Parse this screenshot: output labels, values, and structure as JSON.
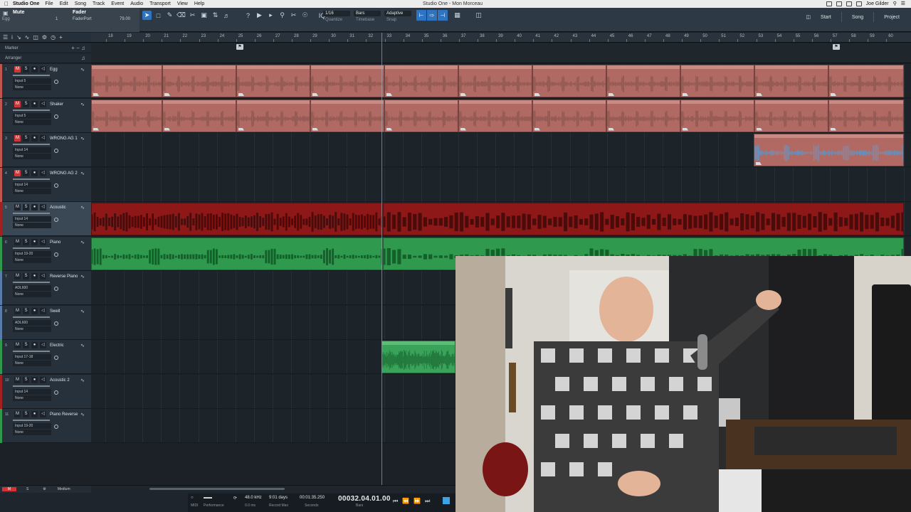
{
  "menubar": {
    "app": "Studio One",
    "items": [
      "File",
      "Edit",
      "Song",
      "Track",
      "Event",
      "Audio",
      "Transport",
      "View",
      "Help"
    ],
    "window_title": "Studio One - Mon Morceau",
    "user": "Joe Gilder"
  },
  "toolbar": {
    "mute_label": "Mute",
    "track_label": "Egg",
    "one_label": "1",
    "fader_label": "Fader",
    "faderport_label": "FaderPort",
    "fader_value": "79.00",
    "quantize": {
      "value": "1/16",
      "label": "Quantize"
    },
    "timebase": {
      "value": "Bars",
      "label": "Timebase"
    },
    "snap": {
      "value": "Adaptive",
      "label": "Snap"
    },
    "start_label": "Start",
    "song_label": "Song",
    "project_label": "Project",
    "accent": "#2f74c0"
  },
  "tracklist": {
    "marker_label": "Marker",
    "arranger_label": "Arranger"
  },
  "ruler": {
    "bars": [
      "18",
      "19",
      "20",
      "21",
      "22",
      "23",
      "24",
      "25",
      "26",
      "27",
      "28",
      "29",
      "30",
      "31",
      "32",
      "33",
      "34",
      "35",
      "36",
      "37",
      "38",
      "39",
      "40",
      "41",
      "42",
      "43",
      "44",
      "45",
      "46",
      "47",
      "48",
      "49",
      "50",
      "51",
      "52",
      "53",
      "54",
      "55",
      "56",
      "57",
      "58",
      "59",
      "60"
    ]
  },
  "tracks": [
    {
      "num": "1",
      "name": "Egg",
      "input": "Input 5",
      "output": "None",
      "color": "#c0564d",
      "mute": true
    },
    {
      "num": "2",
      "name": "Shaker",
      "input": "Input 5",
      "output": "None",
      "color": "#c0564d",
      "mute": true
    },
    {
      "num": "3",
      "name": "WRONG AG 1",
      "input": "Input 14",
      "output": "None",
      "color": "#c0564d",
      "mute": true
    },
    {
      "num": "4",
      "name": "WRONG AG 2",
      "input": "Input 14",
      "output": "None",
      "color": "#c0564d",
      "mute": true
    },
    {
      "num": "5",
      "name": "Acoustic",
      "input": "Input 14",
      "output": "None",
      "color": "#a32020",
      "mute": false
    },
    {
      "num": "6",
      "name": "Piano",
      "input": "Input 19-20",
      "output": "None",
      "color": "#2f9a4d",
      "mute": false
    },
    {
      "num": "7",
      "name": "Reverse Piano",
      "input": "ADL600",
      "output": "None",
      "color": "#5b7ba8",
      "mute": false
    },
    {
      "num": "8",
      "name": "Swell",
      "input": "ADL600",
      "output": "None",
      "color": "#5b7ba8",
      "mute": false
    },
    {
      "num": "9",
      "name": "Electric",
      "input": "Input 17-18",
      "output": "None",
      "color": "#2f9a4d",
      "mute": false
    },
    {
      "num": "10",
      "name": "Acoustic 2",
      "input": "Input 14",
      "output": "None",
      "color": "#a32020",
      "mute": false
    },
    {
      "num": "11",
      "name": "Piano Reverse",
      "input": "Input 19-20",
      "output": "None",
      "color": "#2f9a4d",
      "mute": false
    }
  ],
  "bottom": {
    "m_label": "M",
    "s_label": "S",
    "mode_label": "Medium"
  },
  "transport": {
    "midi_label": "MIDI",
    "performance_label": "Performance",
    "sample_rate": "48.0 kHz",
    "latency": "0.0 ms",
    "record_time": "9:01 days",
    "record_max_label": "Record Max",
    "seconds_value": "00:01:35.250",
    "seconds_label": "Seconds",
    "bars_value": "00032.04.01.00",
    "bars_label": "Bars"
  }
}
